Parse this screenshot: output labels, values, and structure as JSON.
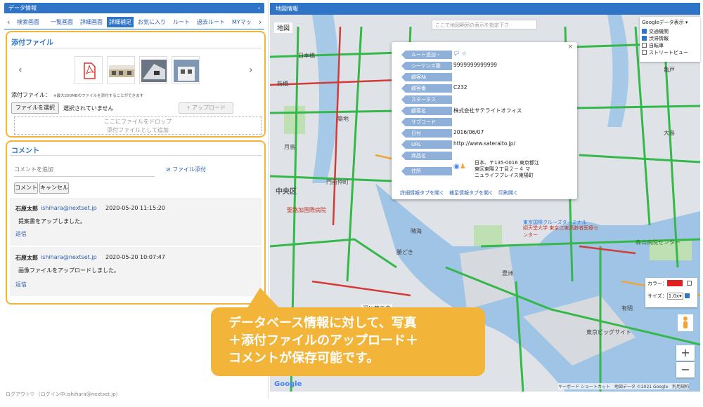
{
  "left": {
    "header": "データ情報",
    "tabs": [
      "検索画面",
      "一覧画面",
      "詳細画面",
      "詳細補足",
      "お気に入り",
      "ルート",
      "過去ルート",
      "MYマッ"
    ],
    "attach": {
      "title": "添付ファイル",
      "label": "添付ファイル：",
      "note": "※最大200MBのファイルを添付することができます",
      "choose_btn": "ファイルを選択",
      "no_file": "選択されていません",
      "upload_btn": "アップロード",
      "drop_line1": "ここにファイルをドロップ",
      "drop_line2": "添付ファイルとして追加"
    },
    "comment": {
      "title": "コメント",
      "placeholder": "コメントを追加",
      "attach_link": "ファイル添付",
      "submit_btn": "コメント",
      "cancel_btn": "キャンセル",
      "items": [
        {
          "author": "石原太郎",
          "email": "ishihara@nextset.jp",
          "time": "2020-05-20 11:15:20",
          "text": "提案書をアップしました。",
          "reply": "返信"
        },
        {
          "author": "石原太郎",
          "email": "ishihara@nextset.jp",
          "time": "2020-05-20 10:07:47",
          "text": "画像ファイルをアップロードしました。",
          "reply": "返信"
        }
      ]
    }
  },
  "footer": "ログアウト▽ （ログイン中:ishihara@nextset.jp）",
  "map": {
    "header": "地図情報",
    "type_label": "地図",
    "search_placeholder": "ここで地図範囲の表示を指定下さ",
    "google_panel": {
      "title": "Googleデータ表示",
      "options": [
        {
          "label": "交通機関",
          "checked": true
        },
        {
          "label": "渋滞情報",
          "checked": true
        },
        {
          "label": "自転車",
          "checked": false
        },
        {
          "label": "ストリートビュー",
          "checked": false
        }
      ]
    },
    "place_labels": [
      "中央区",
      "聖路加国際病院",
      "晴海",
      "月島",
      "豊洲",
      "有明",
      "東京国際クルーズターミナル",
      "日本橋",
      "新橋",
      "築地",
      "勝どき",
      "深川第五中",
      "順天堂大学 東京江東高齢者医療センター",
      "門前仲町",
      "東京ビッグサイト",
      "森山病院センター",
      "大島",
      "亀戸"
    ],
    "popup": {
      "fields": [
        {
          "label": "ルート追加・",
          "value": "🏳 ☆"
        },
        {
          "label": "シーケンス番",
          "value": "9999999999999"
        },
        {
          "label": "顧客№",
          "value": ""
        },
        {
          "label": "顧客番",
          "value": "C232"
        },
        {
          "label": "スタータス",
          "value": ""
        },
        {
          "label": "顧客名",
          "value": "株式会社サテライトオフィス"
        },
        {
          "label": "サブコード",
          "value": ""
        },
        {
          "label": "日付",
          "value": "2016/06/07"
        },
        {
          "label": "URL",
          "value": "http://www.sateraito.jp/"
        },
        {
          "label": "商品名",
          "value": ""
        }
      ],
      "address_label": "住所",
      "address_lines": [
        "日本、〒135-0016 東京都江",
        "東区東陽２丁目２－４ マ",
        "ニュライフプレイス東陽町"
      ],
      "links": [
        "詳細情報タブを開く",
        "補足情報タブを開く",
        "印刷開く"
      ]
    },
    "color_label": "カラー：",
    "size_label": "サイズ：",
    "size_value": "1.0x",
    "zoom_in": "+",
    "zoom_out": "−",
    "attribution": "キーボード ショートカット　地図データ ©2021 Google　利用規約",
    "google_logo": "Google"
  },
  "callout": {
    "lines": [
      "データベース情報に対して、写真",
      "＋添付ファイルのアップロード＋",
      "コメントが保存可能です。"
    ]
  },
  "colors": {
    "accent": "#2f74c7",
    "callout": "#f3b43a",
    "traffic_green": "#34b84a",
    "traffic_red": "#d33a3a"
  }
}
